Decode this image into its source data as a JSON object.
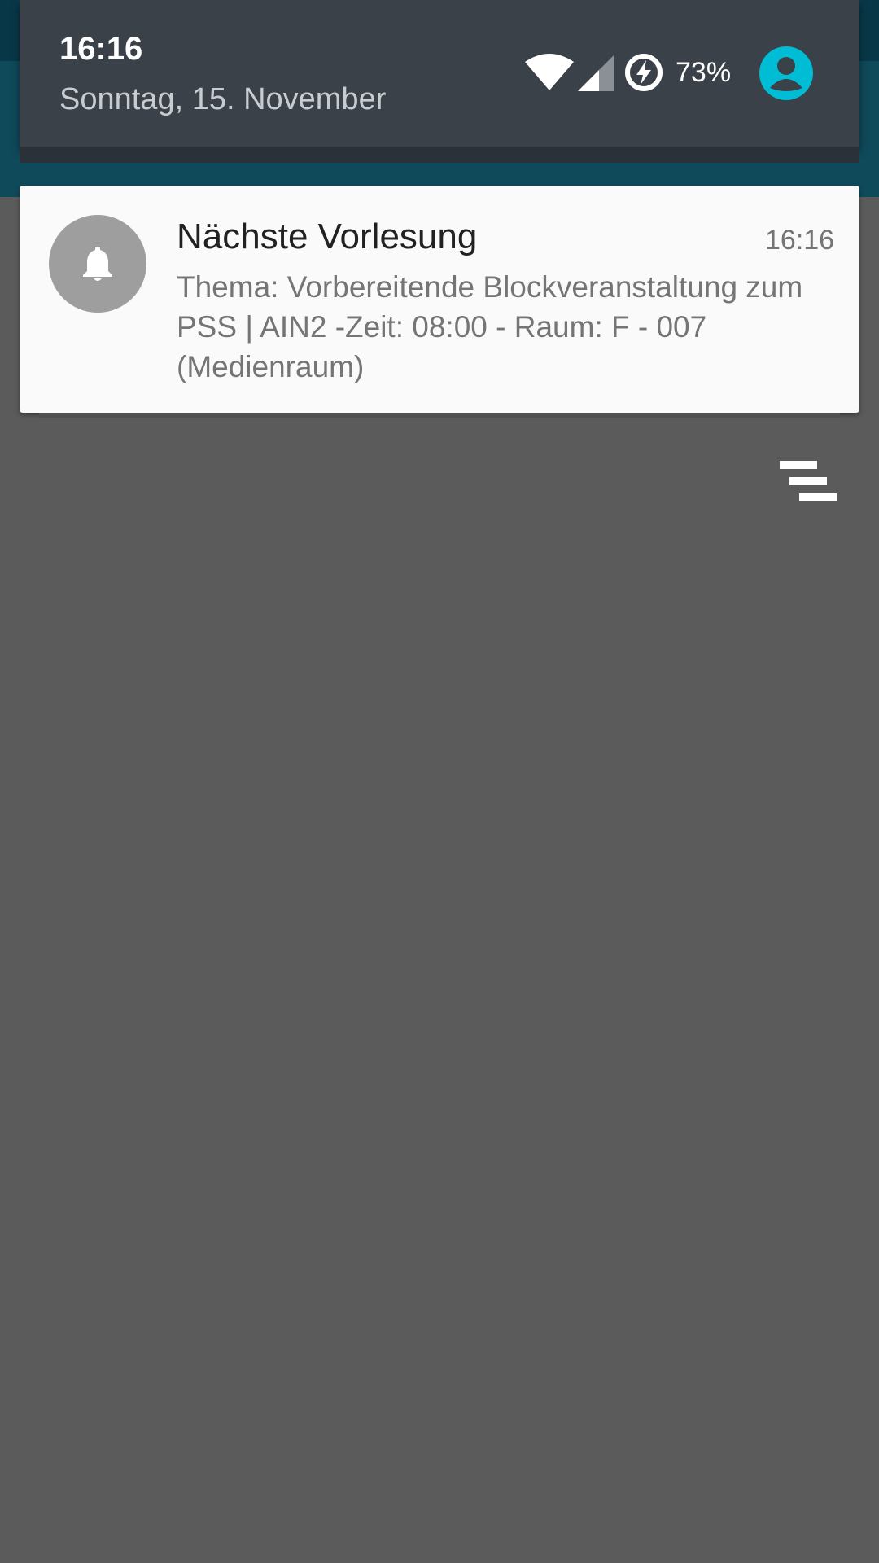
{
  "status_header": {
    "time": "16:16",
    "date": "Sonntag, 15. November",
    "battery_percent": "73%",
    "icons": [
      "wifi-icon",
      "cell-signal-icon",
      "battery-saver-icon",
      "account-avatar-icon"
    ]
  },
  "notifications": [
    {
      "icon": "bell-icon",
      "title": "Nächste Vorlesung",
      "time": "16:16",
      "body": "Thema: Vorbereitende Blockveranstaltung zum PSS | AIN2 -Zeit: 08:00 - Raum: F - 007 (Medienraum)"
    }
  ],
  "actions": {
    "clear_all_icon": "clear-all-icon"
  },
  "colors": {
    "header_bg": "#3a4148",
    "shade_bg": "#5b5b5b",
    "card_bg": "#fafafa",
    "avatar_accent": "#00bcd4",
    "icon_circle": "#9e9e9e"
  }
}
